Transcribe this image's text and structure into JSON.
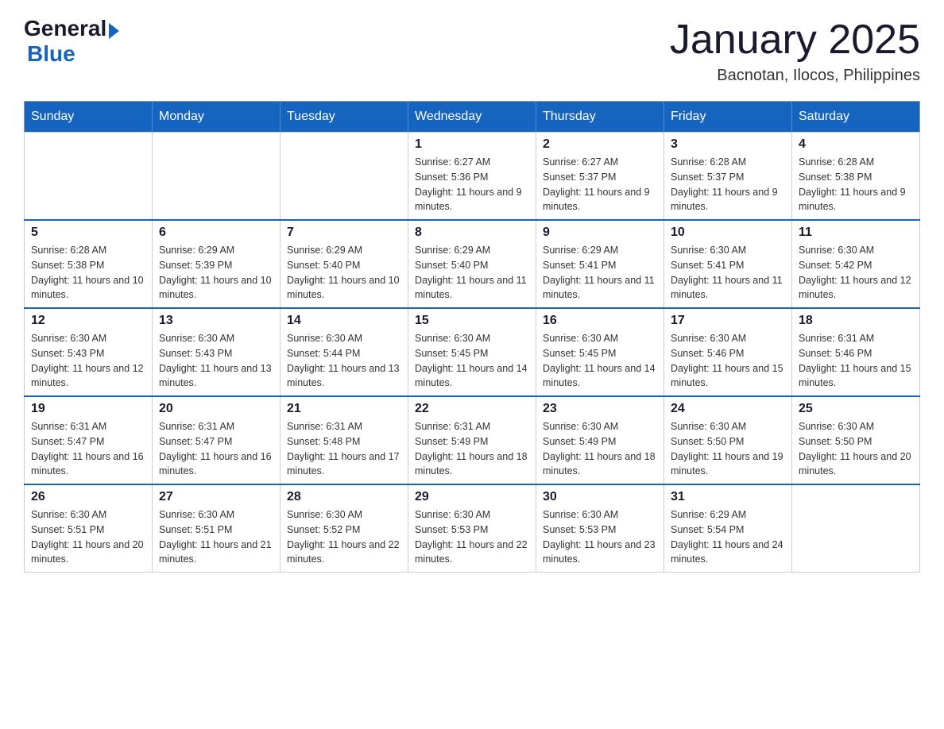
{
  "header": {
    "logo_general": "General",
    "logo_triangle": "▶",
    "logo_blue": "Blue",
    "title": "January 2025",
    "subtitle": "Bacnotan, Ilocos, Philippines"
  },
  "days_of_week": [
    "Sunday",
    "Monday",
    "Tuesday",
    "Wednesday",
    "Thursday",
    "Friday",
    "Saturday"
  ],
  "weeks": [
    {
      "days": [
        {
          "number": "",
          "info": ""
        },
        {
          "number": "",
          "info": ""
        },
        {
          "number": "",
          "info": ""
        },
        {
          "number": "1",
          "info": "Sunrise: 6:27 AM\nSunset: 5:36 PM\nDaylight: 11 hours and 9 minutes."
        },
        {
          "number": "2",
          "info": "Sunrise: 6:27 AM\nSunset: 5:37 PM\nDaylight: 11 hours and 9 minutes."
        },
        {
          "number": "3",
          "info": "Sunrise: 6:28 AM\nSunset: 5:37 PM\nDaylight: 11 hours and 9 minutes."
        },
        {
          "number": "4",
          "info": "Sunrise: 6:28 AM\nSunset: 5:38 PM\nDaylight: 11 hours and 9 minutes."
        }
      ]
    },
    {
      "days": [
        {
          "number": "5",
          "info": "Sunrise: 6:28 AM\nSunset: 5:38 PM\nDaylight: 11 hours and 10 minutes."
        },
        {
          "number": "6",
          "info": "Sunrise: 6:29 AM\nSunset: 5:39 PM\nDaylight: 11 hours and 10 minutes."
        },
        {
          "number": "7",
          "info": "Sunrise: 6:29 AM\nSunset: 5:40 PM\nDaylight: 11 hours and 10 minutes."
        },
        {
          "number": "8",
          "info": "Sunrise: 6:29 AM\nSunset: 5:40 PM\nDaylight: 11 hours and 11 minutes."
        },
        {
          "number": "9",
          "info": "Sunrise: 6:29 AM\nSunset: 5:41 PM\nDaylight: 11 hours and 11 minutes."
        },
        {
          "number": "10",
          "info": "Sunrise: 6:30 AM\nSunset: 5:41 PM\nDaylight: 11 hours and 11 minutes."
        },
        {
          "number": "11",
          "info": "Sunrise: 6:30 AM\nSunset: 5:42 PM\nDaylight: 11 hours and 12 minutes."
        }
      ]
    },
    {
      "days": [
        {
          "number": "12",
          "info": "Sunrise: 6:30 AM\nSunset: 5:43 PM\nDaylight: 11 hours and 12 minutes."
        },
        {
          "number": "13",
          "info": "Sunrise: 6:30 AM\nSunset: 5:43 PM\nDaylight: 11 hours and 13 minutes."
        },
        {
          "number": "14",
          "info": "Sunrise: 6:30 AM\nSunset: 5:44 PM\nDaylight: 11 hours and 13 minutes."
        },
        {
          "number": "15",
          "info": "Sunrise: 6:30 AM\nSunset: 5:45 PM\nDaylight: 11 hours and 14 minutes."
        },
        {
          "number": "16",
          "info": "Sunrise: 6:30 AM\nSunset: 5:45 PM\nDaylight: 11 hours and 14 minutes."
        },
        {
          "number": "17",
          "info": "Sunrise: 6:30 AM\nSunset: 5:46 PM\nDaylight: 11 hours and 15 minutes."
        },
        {
          "number": "18",
          "info": "Sunrise: 6:31 AM\nSunset: 5:46 PM\nDaylight: 11 hours and 15 minutes."
        }
      ]
    },
    {
      "days": [
        {
          "number": "19",
          "info": "Sunrise: 6:31 AM\nSunset: 5:47 PM\nDaylight: 11 hours and 16 minutes."
        },
        {
          "number": "20",
          "info": "Sunrise: 6:31 AM\nSunset: 5:47 PM\nDaylight: 11 hours and 16 minutes."
        },
        {
          "number": "21",
          "info": "Sunrise: 6:31 AM\nSunset: 5:48 PM\nDaylight: 11 hours and 17 minutes."
        },
        {
          "number": "22",
          "info": "Sunrise: 6:31 AM\nSunset: 5:49 PM\nDaylight: 11 hours and 18 minutes."
        },
        {
          "number": "23",
          "info": "Sunrise: 6:30 AM\nSunset: 5:49 PM\nDaylight: 11 hours and 18 minutes."
        },
        {
          "number": "24",
          "info": "Sunrise: 6:30 AM\nSunset: 5:50 PM\nDaylight: 11 hours and 19 minutes."
        },
        {
          "number": "25",
          "info": "Sunrise: 6:30 AM\nSunset: 5:50 PM\nDaylight: 11 hours and 20 minutes."
        }
      ]
    },
    {
      "days": [
        {
          "number": "26",
          "info": "Sunrise: 6:30 AM\nSunset: 5:51 PM\nDaylight: 11 hours and 20 minutes."
        },
        {
          "number": "27",
          "info": "Sunrise: 6:30 AM\nSunset: 5:51 PM\nDaylight: 11 hours and 21 minutes."
        },
        {
          "number": "28",
          "info": "Sunrise: 6:30 AM\nSunset: 5:52 PM\nDaylight: 11 hours and 22 minutes."
        },
        {
          "number": "29",
          "info": "Sunrise: 6:30 AM\nSunset: 5:53 PM\nDaylight: 11 hours and 22 minutes."
        },
        {
          "number": "30",
          "info": "Sunrise: 6:30 AM\nSunset: 5:53 PM\nDaylight: 11 hours and 23 minutes."
        },
        {
          "number": "31",
          "info": "Sunrise: 6:29 AM\nSunset: 5:54 PM\nDaylight: 11 hours and 24 minutes."
        },
        {
          "number": "",
          "info": ""
        }
      ]
    }
  ]
}
